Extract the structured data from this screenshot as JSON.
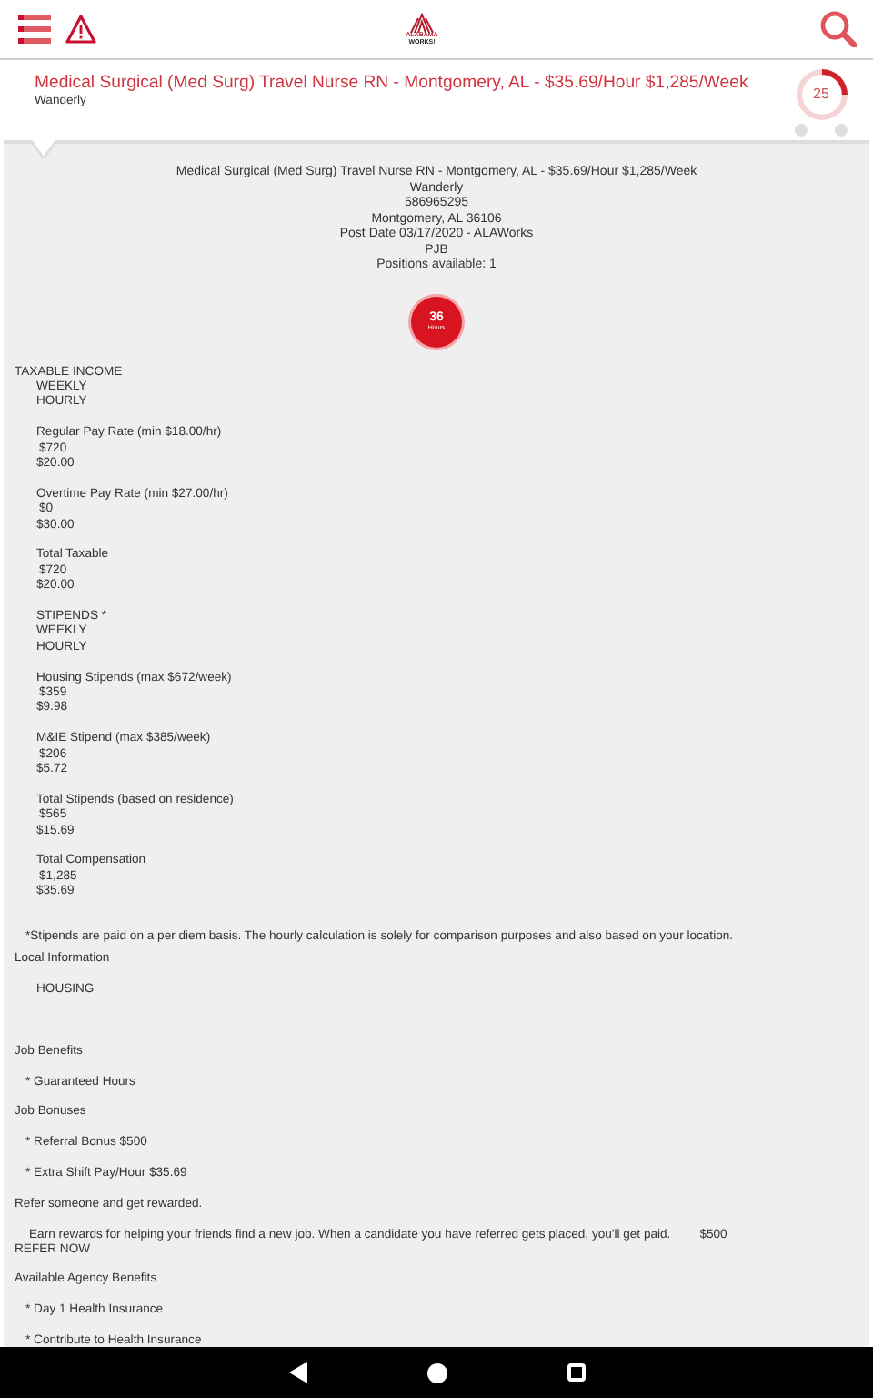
{
  "header": {
    "logo": [
      "ALABAMA",
      "WORKS!"
    ]
  },
  "job": {
    "title": "Medical Surgical (Med Surg) Travel Nurse RN - Montgomery, AL - $35.69/Hour $1,285/Week",
    "company": "Wanderly",
    "match": "25"
  },
  "details": {
    "lines": [
      "Medical Surgical (Med Surg) Travel Nurse RN - Montgomery, AL - $35.69/Hour $1,285/Week",
      "Wanderly",
      "586965295",
      "Montgomery, AL 36106",
      "Post Date 03/17/2020 - ALAWorks",
      "PJB",
      "Positions available: 1"
    ],
    "hours": {
      "value": "36",
      "unit": "Hours"
    }
  },
  "pay_groups": [
    {
      "heading": "TAXABLE INCOME",
      "columns": [
        "WEEKLY",
        "HOURLY"
      ],
      "items": [
        {
          "label": "Regular Pay Rate (min $18.00/hr)",
          "weekly": "$720",
          "hourly": "$20.00"
        },
        {
          "label": "Overtime Pay Rate (min $27.00/hr)",
          "weekly": "$0",
          "hourly": "$30.00"
        },
        {
          "label": "Total Taxable",
          "weekly": "$720",
          "hourly": "$20.00"
        }
      ]
    },
    {
      "heading": "STIPENDS *",
      "columns": [
        "WEEKLY",
        "HOURLY"
      ],
      "items": [
        {
          "label": "Housing Stipends (max $672/week)",
          "weekly": "$359",
          "hourly": "$9.98"
        },
        {
          "label": "M&IE Stipend (max $385/week)",
          "weekly": "$206",
          "hourly": "$5.72"
        },
        {
          "label": "Total Stipends (based on residence)",
          "weekly": "$565",
          "hourly": "$15.69"
        },
        {
          "label": "Total Compensation",
          "weekly": "$1,285",
          "hourly": "$35.69"
        }
      ]
    }
  ],
  "footnote": "*Stipends are paid on a per diem basis. The hourly calculation is solely for comparison purposes and also based on your location.",
  "sections": [
    {
      "title": "Local Information",
      "items": [
        {
          "kind": "label",
          "text": "HOUSING"
        }
      ]
    },
    {
      "title": "Job Benefits",
      "items": [
        {
          "kind": "bullet",
          "text": "* Guaranteed Hours"
        }
      ]
    },
    {
      "title": "Job Bonuses",
      "items": [
        {
          "kind": "bullet",
          "text": "* Referral Bonus $500"
        },
        {
          "kind": "bullet",
          "text": "* Extra Shift Pay/Hour $35.69"
        }
      ]
    },
    {
      "title": "Refer someone and get rewarded.",
      "items": [
        {
          "kind": "referral",
          "text": "Earn rewards for helping your friends find a new job. When a candidate you have referred gets placed, you'll get paid.",
          "amount": "$500",
          "link": "REFER NOW"
        }
      ]
    },
    {
      "title": "Available Agency Benefits",
      "items": [
        {
          "kind": "bullet",
          "text": "* Day 1 Health Insurance"
        },
        {
          "kind": "bullet",
          "text": "* Contribute to Health Insurance"
        }
      ]
    }
  ]
}
